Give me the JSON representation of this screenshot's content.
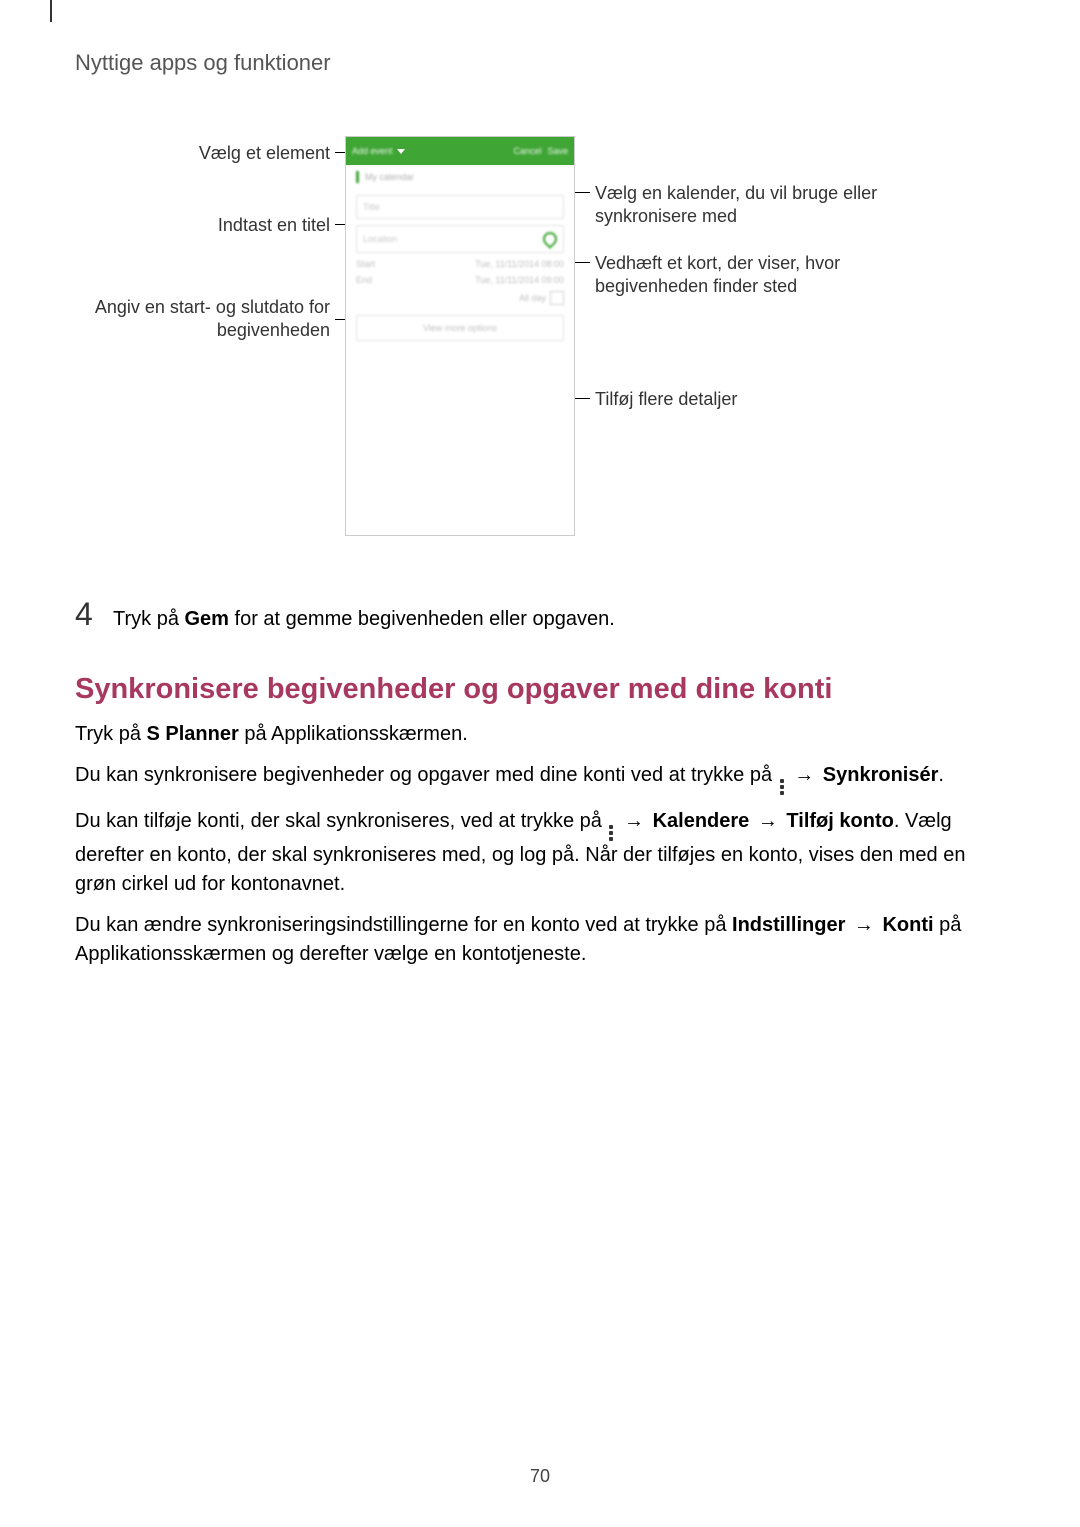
{
  "page_number": "70",
  "section_title": "Nyttige apps og funktioner",
  "callouts": {
    "choose_element": "Vælg et element",
    "enter_title": "Indtast en titel",
    "set_dates": "Angiv en start- og slutdato for begivenheden",
    "choose_calendar": "Vælg en kalender, du vil bruge eller synkronisere med",
    "attach_map": "Vedhæft et kort, der viser, hvor begivenheden finder sted",
    "more_details": "Tilføj flere detaljer"
  },
  "phone": {
    "header_title": "Add event",
    "header_cancel": "Cancel",
    "header_save": "Save",
    "calendar_label": "My calendar",
    "title_placeholder": "Title",
    "location_placeholder": "Location",
    "start_label": "Start",
    "start_value": "Tue, 11/11/2014  08:00",
    "end_label": "End",
    "end_value": "Tue, 11/11/2014  09:00",
    "allday_label": "All day",
    "more_options": "View more options"
  },
  "step4": {
    "number": "4",
    "prefix": "Tryk på ",
    "bold": "Gem",
    "suffix": " for at gemme begivenheden eller opgaven."
  },
  "heading": "Synkronisere begivenheder og opgaver med dine konti",
  "p1": {
    "a": "Tryk på ",
    "b": "S Planner",
    "c": " på Applikationsskærmen."
  },
  "p2": {
    "a": "Du kan synkronisere begivenheder og opgaver med dine konti ved at trykke på ",
    "arrow": " → ",
    "b": "Synkronisér",
    "c": "."
  },
  "p3": {
    "a": "Du kan tilføje konti, der skal synkroniseres, ved at trykke på ",
    "arrow1": " → ",
    "b": "Kalendere",
    "arrow2": " → ",
    "c": "Tilføj konto",
    "d": ". Vælg derefter en konto, der skal synkroniseres med, og log på. Når der tilføjes en konto, vises den med en grøn cirkel ud for kontonavnet."
  },
  "p4": {
    "a": "Du kan ændre synkroniseringsindstillingerne for en konto ved at trykke på ",
    "b": "Indstillinger",
    "arrow": " → ",
    "c": "Konti",
    "d": " på Applikationsskærmen og derefter vælge en kontotjeneste."
  }
}
